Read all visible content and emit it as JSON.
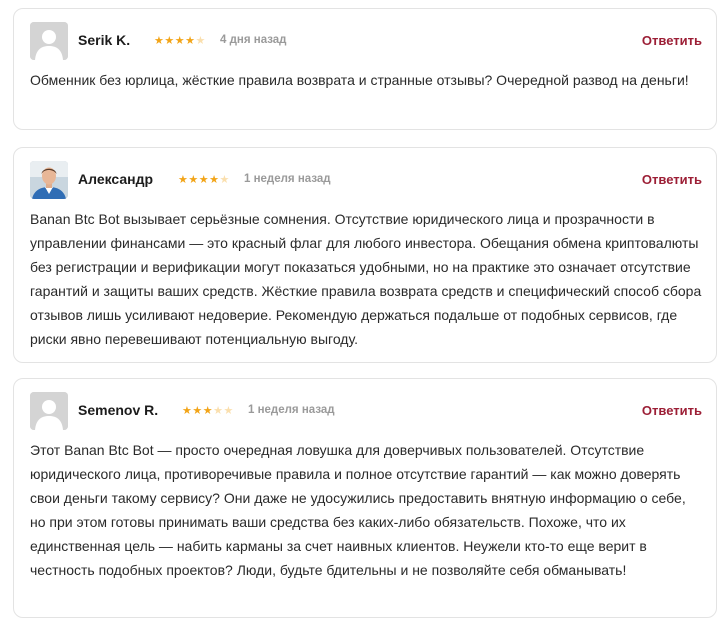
{
  "reviews": [
    {
      "author": "Serik K.",
      "rating": 4,
      "rating_max": 5,
      "date": "4 дня назад",
      "reply_label": "Ответить",
      "avatar": "placeholder-avatar",
      "text": "Обменник без юрлица, жёсткие правила возврата и странные отзывы? Очередной развод на деньги!"
    },
    {
      "author": "Александр",
      "rating": 4,
      "rating_max": 5,
      "date": "1 неделя назад",
      "reply_label": "Ответить",
      "avatar": "photo-avatar",
      "text": "Banan Btc Bot вызывает серьёзные сомнения. Отсутствие юридического лица и прозрачности в управлении финансами — это красный флаг для любого инвестора. Обещания обмена криптовалюты без регистрации и верификации могут показаться удобными, но на практике это означает отсутствие гарантий и защиты ваших средств. Жёсткие правила возврата средств и специфический способ сбора отзывов лишь усиливают недоверие. Рекомендую держаться подальше от подобных сервисов, где риски явно перевешивают потенциальную выгоду."
    },
    {
      "author": "Semenov R.",
      "rating": 3,
      "rating_max": 5,
      "date": "1 неделя назад",
      "reply_label": "Ответить",
      "avatar": "placeholder-avatar",
      "text": "Этот Banan Btc Bot — просто очередная ловушка для доверчивых пользователей. Отсутствие юридического лица, противоречивые правила и полное отсутствие гарантий — как можно доверять свои деньги такому сервису? Они даже не удосужились предоставить внятную информацию о себе, но при этом готовы принимать ваши средства без каких-либо обязательств. Похоже, что их единственная цель — набить карманы за счет наивных клиентов. Неужели кто-то еще верит в честность подобных проектов? Люди, будьте бдительны и не позволяйте себя обманывать!"
    }
  ],
  "colors": {
    "star": "#f2a417",
    "reply": "#9c1f36",
    "date": "#9a9a9a",
    "border": "#e3e3e3"
  }
}
